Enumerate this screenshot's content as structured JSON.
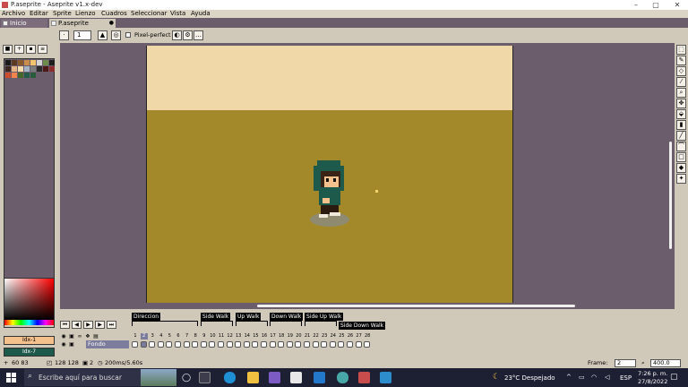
{
  "window": {
    "title": "P.aseprite - Aseprite v1.x-dev",
    "minimize": "–",
    "maximize": "▢",
    "close": "✕"
  },
  "menu": [
    "Archivo",
    "Editar",
    "Sprite",
    "Lienzo",
    "Cuadros",
    "Seleccionar",
    "Vista",
    "Ayuda"
  ],
  "tabs": [
    {
      "label": "Inicio"
    },
    {
      "label": "P.aseprite"
    }
  ],
  "toolbar": {
    "brush_size": "1",
    "pixel_perfect_label": "Pixel-perfect"
  },
  "palette": {
    "colors": [
      "#1a1a1a",
      "#5c3a21",
      "#8b5a2b",
      "#c88c4c",
      "#f4c46c",
      "#d4d4d4",
      "#6c8c4c",
      "#1e1e1e",
      "#3c2820",
      "#e4b484",
      "#f4dcac",
      "#a4b4c4",
      "#7c7c7c",
      "#2a2a2a",
      "#4c1818",
      "#8c2c2c",
      "#cc4c2c",
      "#f4844c",
      "#44682c",
      "#245c4c",
      "#285c3c"
    ],
    "fg_label": "Idx-1",
    "bg_label": "Idx-7",
    "fg_color": "#f4c08c",
    "bg_color": "#1e5a4c"
  },
  "timeline": {
    "tags": [
      {
        "label": "Direccion"
      },
      {
        "label": "Side Walk"
      },
      {
        "label": "Up Walk"
      },
      {
        "label": "Down Walk"
      },
      {
        "label": "Side Up Walk"
      },
      {
        "label": "Side Down Walk"
      }
    ],
    "frames": [
      "1",
      "2",
      "3",
      "4",
      "5",
      "6",
      "7",
      "8",
      "9",
      "10",
      "11",
      "12",
      "13",
      "14",
      "15",
      "16",
      "17",
      "18",
      "19",
      "20",
      "21",
      "22",
      "23",
      "24",
      "25",
      "26",
      "27",
      "28"
    ],
    "layer_name": "Fondo"
  },
  "status": {
    "position": "60 83",
    "size": "128 128",
    "frame_info": "2",
    "duration": "200ms/5.60s",
    "frame_label": "Frame:",
    "frame_value": "2",
    "zoom": "400.0"
  },
  "taskbar": {
    "search_placeholder": "Escribe aquí para buscar",
    "weather": "23°C  Despejado",
    "language": "ESP",
    "time": "7:26 p. m.",
    "date": "27/8/2022"
  }
}
